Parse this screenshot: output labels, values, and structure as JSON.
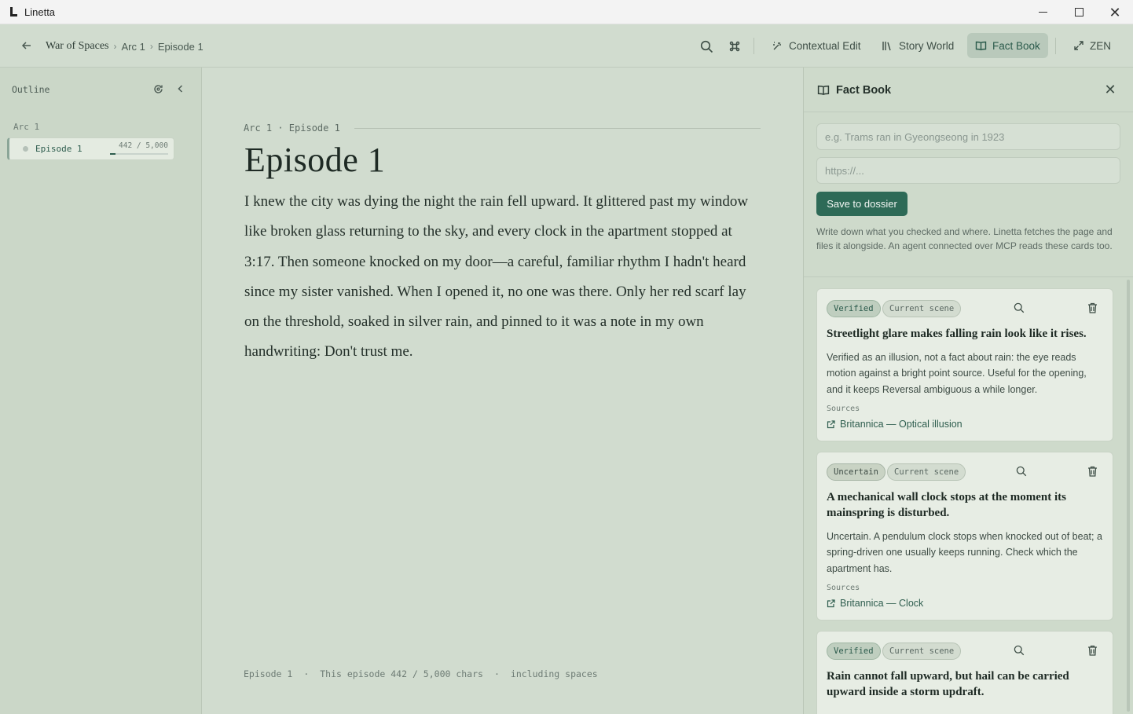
{
  "window": {
    "title": "Linetta"
  },
  "toolbar": {
    "breadcrumb": [
      "War of Spaces",
      "Arc 1",
      "Episode 1"
    ],
    "contextual_edit": "Contextual Edit",
    "story_world": "Story World",
    "fact_book": "Fact Book",
    "zen": "ZEN"
  },
  "sidebar": {
    "title": "Outline",
    "arc_label": "Arc 1",
    "episode": {
      "name": "Episode 1",
      "count": "442 / 5,000",
      "progress": 0.0884
    }
  },
  "editor": {
    "crumb": "Arc 1 · Episode 1",
    "title": "Episode 1",
    "body": "I knew the city was dying the night the rain fell upward. It glittered past my window like broken glass returning to the sky, and every clock in the apartment stopped at 3:17. Then someone knocked on my door—a careful, familiar rhythm I hadn't heard since my sister vanished. When I opened it, no one was there. Only her red scarf lay on the threshold, soaked in silver rain, and pinned to it was a note in my own handwriting: Don't trust me.",
    "status": [
      "Episode 1",
      "·",
      "This episode 442 / 5,000 chars",
      "·",
      "including spaces"
    ]
  },
  "factbook": {
    "title": "Fact Book",
    "fact_placeholder": "e.g. Trams ran in Gyeongseong in 1923",
    "url_placeholder": "https://...",
    "save_label": "Save to dossier",
    "help": "Write down what you checked and where. Linetta fetches the page and files it alongside. An agent connected over MCP reads these cards too.",
    "cards": [
      {
        "status": "Verified",
        "scope": "Current scene",
        "title": "Streetlight glare makes falling rain look like it rises.",
        "text": "Verified as an illusion, not a fact about rain: the eye reads motion against a bright point source. Useful for the opening, and it keeps Reversal ambiguous a while longer.",
        "sources_label": "Sources",
        "source": "Britannica — Optical illusion"
      },
      {
        "status": "Uncertain",
        "scope": "Current scene",
        "title": "A mechanical wall clock stops at the moment its mainspring is disturbed.",
        "text": "Uncertain. A pendulum clock stops when knocked out of beat; a spring-driven one usually keeps running. Check which the apartment has.",
        "sources_label": "Sources",
        "source": "Britannica — Clock"
      },
      {
        "status": "Verified",
        "scope": "Current scene",
        "title": "Rain cannot fall upward, but hail can be carried upward inside a storm updraft."
      }
    ]
  },
  "colors": {
    "accent": "#2e6a57",
    "background": "#d1dccf",
    "panel": "#cedacb"
  }
}
